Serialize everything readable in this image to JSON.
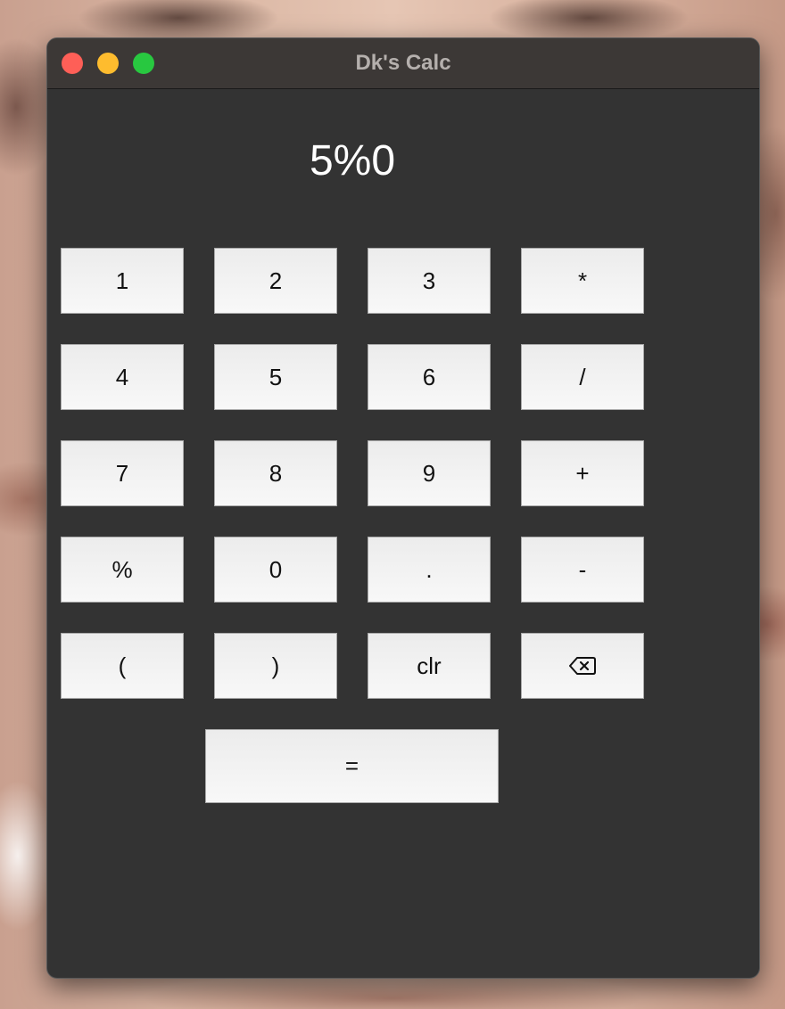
{
  "window": {
    "title": "Dk's Calc"
  },
  "display": {
    "value": "5%0"
  },
  "keys": {
    "k1": "1",
    "k2": "2",
    "k3": "3",
    "mul": "*",
    "k4": "4",
    "k5": "5",
    "k6": "6",
    "div": "/",
    "k7": "7",
    "k8": "8",
    "k9": "9",
    "add": "+",
    "mod": "%",
    "k0": "0",
    "dot": ".",
    "sub": "-",
    "lparen": "(",
    "rparen": ")",
    "clr": "clr",
    "backspace_icon": "backspace-icon",
    "equals": "="
  },
  "colors": {
    "window_bg": "#333333",
    "titlebar_bg": "#3c3836",
    "close": "#fe5f57",
    "minimize": "#febc2e",
    "maximize": "#28c840"
  }
}
